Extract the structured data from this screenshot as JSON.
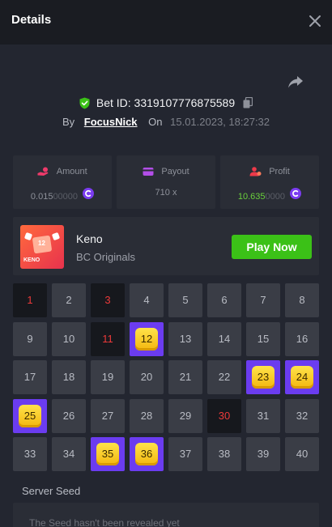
{
  "header": {
    "title": "Details"
  },
  "bet": {
    "id_label": "Bet ID: 3319107776875589",
    "by_label": "By",
    "user": "FocusNick",
    "on_label": "On",
    "date": "15.01.2023, 18:27:32"
  },
  "stats": {
    "amount": {
      "label": "Amount",
      "value_main": "0.015",
      "value_dim": "00000"
    },
    "payout": {
      "label": "Payout",
      "value": "710 x"
    },
    "profit": {
      "label": "Profit",
      "value_main": "10.635",
      "value_dim": "0000"
    }
  },
  "game": {
    "name": "Keno",
    "provider": "BC Originals",
    "play_label": "Play Now",
    "thumb_label": "KENO",
    "thumb_number": "12"
  },
  "keno": {
    "numbers": [
      1,
      2,
      3,
      4,
      5,
      6,
      7,
      8,
      9,
      10,
      11,
      12,
      13,
      14,
      15,
      16,
      17,
      18,
      19,
      20,
      21,
      22,
      23,
      24,
      25,
      26,
      27,
      28,
      29,
      30,
      31,
      32,
      33,
      34,
      35,
      36,
      37,
      38,
      39,
      40
    ],
    "misses": [
      1,
      3,
      11,
      30
    ],
    "hits": [
      12,
      23,
      24,
      25,
      35,
      36
    ]
  },
  "seed": {
    "title": "Server Seed",
    "text": "The Seed hasn't been revealed yet"
  },
  "colors": {
    "background": "#232630",
    "panel": "#2a2d36",
    "hit": "#6b3cf0",
    "miss_text": "#ed3a3a",
    "play_button": "#3bc117",
    "profit": "#6ad03c"
  },
  "icons": {
    "close": "close-icon",
    "share": "share-icon",
    "verified": "shield-check-icon",
    "copy": "copy-icon",
    "amount": "hand-coin-icon",
    "payout": "wallet-icon",
    "profit": "profit-user-icon",
    "coin": "bcd-coin-icon"
  }
}
